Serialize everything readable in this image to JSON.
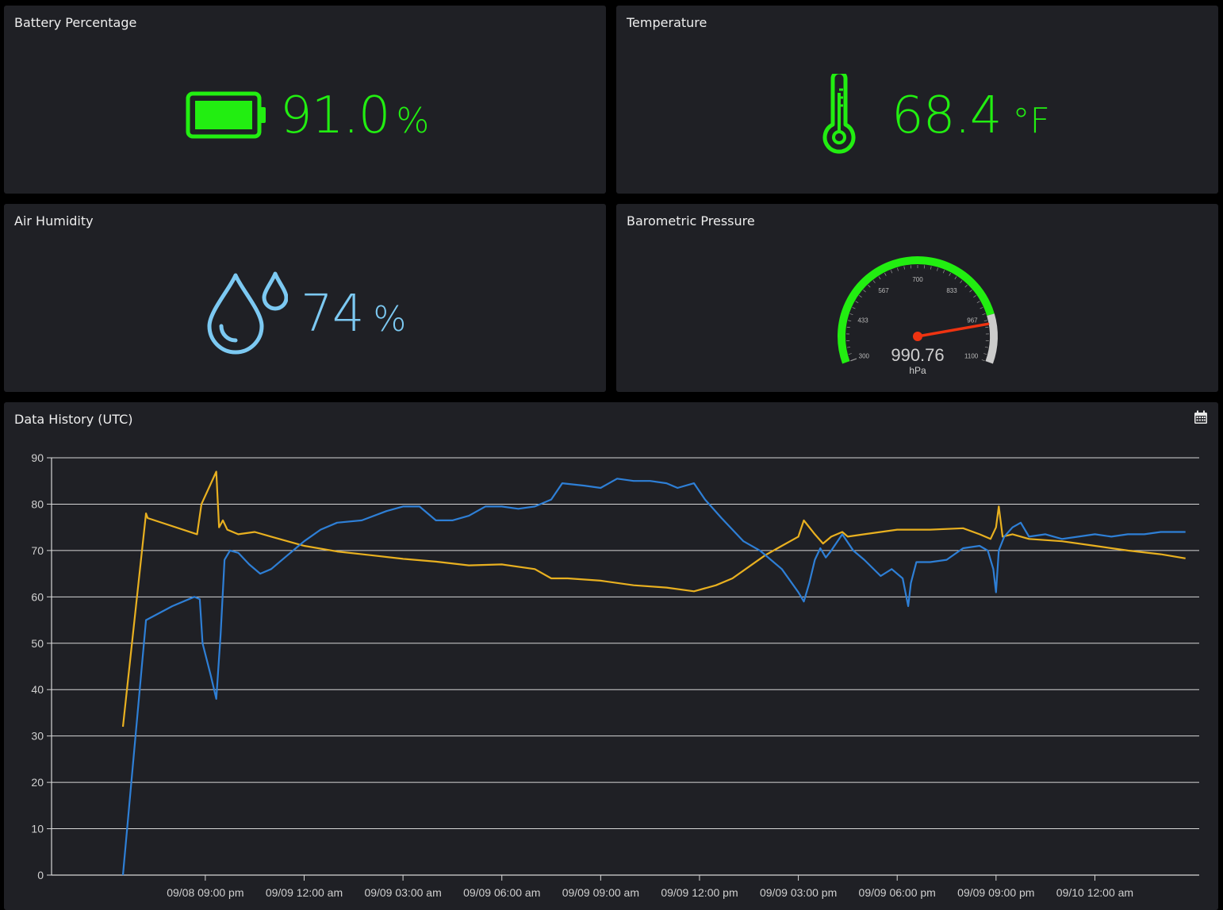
{
  "battery": {
    "title": "Battery Percentage",
    "value": "91.0",
    "unit": "%",
    "icon": "battery-full-icon",
    "color": "#22ee11"
  },
  "temperature": {
    "title": "Temperature",
    "value": "68.4",
    "unit": "°F",
    "icon": "thermometer-icon",
    "color": "#22ee11"
  },
  "humidity": {
    "title": "Air Humidity",
    "value": "74",
    "unit": "%",
    "icon": "water-drops-icon",
    "color": "#7cc9f2"
  },
  "pressure": {
    "title": "Barometric Pressure",
    "value": "990.76",
    "unit": "hPa",
    "min": 300,
    "max": 1100,
    "ticks": [
      "300",
      "433",
      "567",
      "700",
      "833",
      "967",
      "1100"
    ],
    "green_until": 967,
    "arc_color": "#22ee11",
    "rest_color": "#cccccc",
    "needle_color": "#ee3311"
  },
  "history": {
    "title": "Data History (UTC)",
    "calendar_icon": "calendar-icon"
  },
  "chart_data": {
    "type": "line",
    "title": "Data History (UTC)",
    "xlabel": "",
    "ylabel": "",
    "ylim": [
      0,
      90
    ],
    "yticks": [
      0,
      10,
      20,
      30,
      40,
      50,
      60,
      70,
      80,
      90
    ],
    "xlim": [
      "09/08 16:20",
      "09/10 03:10"
    ],
    "xticks": [
      {
        "label": "09/08 09:00 pm",
        "t": "09/08 21:00"
      },
      {
        "label": "09/09 12:00 am",
        "t": "09/09 00:00"
      },
      {
        "label": "09/09 03:00 am",
        "t": "09/09 03:00"
      },
      {
        "label": "09/09 06:00 am",
        "t": "09/09 06:00"
      },
      {
        "label": "09/09 09:00 am",
        "t": "09/09 09:00"
      },
      {
        "label": "09/09 12:00 pm",
        "t": "09/09 12:00"
      },
      {
        "label": "09/09 03:00 pm",
        "t": "09/09 15:00"
      },
      {
        "label": "09/09 06:00 pm",
        "t": "09/09 18:00"
      },
      {
        "label": "09/09 09:00 pm",
        "t": "09/09 21:00"
      },
      {
        "label": "09/10 12:00 am",
        "t": "09/10 00:00"
      }
    ],
    "grid": true,
    "series": [
      {
        "color": "#e8b020",
        "points": [
          [
            "09/08 18:30",
            32
          ],
          [
            "09/08 19:12",
            78
          ],
          [
            "09/08 19:15",
            77
          ],
          [
            "09/08 20:45",
            73.5
          ],
          [
            "09/08 20:53",
            80
          ],
          [
            "09/08 21:20",
            87
          ],
          [
            "09/08 21:25",
            75
          ],
          [
            "09/08 21:32",
            76.5
          ],
          [
            "09/08 21:40",
            74.5
          ],
          [
            "09/08 22:00",
            73.5
          ],
          [
            "09/08 22:30",
            74
          ],
          [
            "09/08 23:00",
            73
          ],
          [
            "09/09 00:00",
            71
          ],
          [
            "09/09 01:00",
            69.8
          ],
          [
            "09/09 02:00",
            69
          ],
          [
            "09/09 03:00",
            68.2
          ],
          [
            "09/09 04:00",
            67.6
          ],
          [
            "09/09 05:00",
            66.8
          ],
          [
            "09/09 06:00",
            67
          ],
          [
            "09/09 07:00",
            66
          ],
          [
            "09/09 07:30",
            64
          ],
          [
            "09/09 08:00",
            64
          ],
          [
            "09/09 09:00",
            63.5
          ],
          [
            "09/09 10:00",
            62.5
          ],
          [
            "09/09 11:00",
            62
          ],
          [
            "09/09 11:50",
            61.2
          ],
          [
            "09/09 12:30",
            62.5
          ],
          [
            "09/09 13:00",
            64
          ],
          [
            "09/09 13:30",
            66.5
          ],
          [
            "09/09 14:00",
            69
          ],
          [
            "09/09 14:30",
            71
          ],
          [
            "09/09 15:00",
            73
          ],
          [
            "09/09 15:10",
            76.5
          ],
          [
            "09/09 15:30",
            73.5
          ],
          [
            "09/09 15:45",
            71.5
          ],
          [
            "09/09 16:00",
            73
          ],
          [
            "09/09 16:20",
            74
          ],
          [
            "09/09 16:30",
            73
          ],
          [
            "09/09 17:00",
            73.5
          ],
          [
            "09/09 18:00",
            74.5
          ],
          [
            "09/09 19:00",
            74.5
          ],
          [
            "09/09 20:00",
            74.8
          ],
          [
            "09/09 20:30",
            73.5
          ],
          [
            "09/09 20:50",
            72.5
          ],
          [
            "09/09 21:00",
            75
          ],
          [
            "09/09 21:05",
            79.5
          ],
          [
            "09/09 21:12",
            73
          ],
          [
            "09/09 21:30",
            73.5
          ],
          [
            "09/09 22:00",
            72.5
          ],
          [
            "09/09 23:00",
            72
          ],
          [
            "09/10 00:00",
            71
          ],
          [
            "09/10 01:00",
            70
          ],
          [
            "09/10 02:00",
            69.2
          ],
          [
            "09/10 02:45",
            68.3
          ]
        ]
      },
      {
        "color": "#2e7fd6",
        "points": [
          [
            "09/08 18:30",
            0
          ],
          [
            "09/08 19:12",
            55
          ],
          [
            "09/08 20:00",
            58
          ],
          [
            "09/08 20:40",
            60
          ],
          [
            "09/08 20:50",
            59.5
          ],
          [
            "09/08 20:55",
            50
          ],
          [
            "09/08 21:10",
            43
          ],
          [
            "09/08 21:20",
            38
          ],
          [
            "09/08 21:28",
            52
          ],
          [
            "09/08 21:35",
            68
          ],
          [
            "09/08 21:45",
            70
          ],
          [
            "09/08 22:00",
            69.5
          ],
          [
            "09/08 22:20",
            67
          ],
          [
            "09/08 22:40",
            65
          ],
          [
            "09/08 23:00",
            66
          ],
          [
            "09/08 23:30",
            69
          ],
          [
            "09/09 00:00",
            72
          ],
          [
            "09/09 00:30",
            74.5
          ],
          [
            "09/09 01:00",
            76
          ],
          [
            "09/09 01:45",
            76.5
          ],
          [
            "09/09 02:30",
            78.5
          ],
          [
            "09/09 03:00",
            79.5
          ],
          [
            "09/09 03:30",
            79.5
          ],
          [
            "09/09 04:00",
            76.5
          ],
          [
            "09/09 04:30",
            76.5
          ],
          [
            "09/09 05:00",
            77.5
          ],
          [
            "09/09 05:30",
            79.5
          ],
          [
            "09/09 06:00",
            79.5
          ],
          [
            "09/09 06:30",
            79
          ],
          [
            "09/09 07:00",
            79.5
          ],
          [
            "09/09 07:30",
            81
          ],
          [
            "09/09 07:50",
            84.5
          ],
          [
            "09/09 08:30",
            84
          ],
          [
            "09/09 09:00",
            83.5
          ],
          [
            "09/09 09:30",
            85.5
          ],
          [
            "09/09 10:00",
            85
          ],
          [
            "09/09 10:30",
            85
          ],
          [
            "09/09 11:00",
            84.5
          ],
          [
            "09/09 11:20",
            83.5
          ],
          [
            "09/09 11:50",
            84.5
          ],
          [
            "09/09 12:10",
            81
          ],
          [
            "09/09 12:40",
            77
          ],
          [
            "09/09 13:20",
            72
          ],
          [
            "09/09 13:50",
            70
          ],
          [
            "09/09 14:30",
            66
          ],
          [
            "09/09 15:00",
            61
          ],
          [
            "09/09 15:10",
            59
          ],
          [
            "09/09 15:20",
            63
          ],
          [
            "09/09 15:30",
            68
          ],
          [
            "09/09 15:40",
            70.5
          ],
          [
            "09/09 15:50",
            68.5
          ],
          [
            "09/09 16:00",
            70
          ],
          [
            "09/09 16:20",
            73.5
          ],
          [
            "09/09 16:40",
            70
          ],
          [
            "09/09 17:00",
            68
          ],
          [
            "09/09 17:30",
            64.5
          ],
          [
            "09/09 17:50",
            66
          ],
          [
            "09/09 18:10",
            64
          ],
          [
            "09/09 18:20",
            58
          ],
          [
            "09/09 18:25",
            63
          ],
          [
            "09/09 18:35",
            67.5
          ],
          [
            "09/09 19:00",
            67.5
          ],
          [
            "09/09 19:30",
            68
          ],
          [
            "09/09 20:00",
            70.5
          ],
          [
            "09/09 20:30",
            71
          ],
          [
            "09/09 20:45",
            70
          ],
          [
            "09/09 20:55",
            66
          ],
          [
            "09/09 21:00",
            61
          ],
          [
            "09/09 21:05",
            70
          ],
          [
            "09/09 21:15",
            73
          ],
          [
            "09/09 21:30",
            75
          ],
          [
            "09/09 21:45",
            76
          ],
          [
            "09/09 22:00",
            73
          ],
          [
            "09/09 22:30",
            73.5
          ],
          [
            "09/09 23:00",
            72.5
          ],
          [
            "09/09 23:30",
            73
          ],
          [
            "09/10 00:00",
            73.5
          ],
          [
            "09/10 00:30",
            73
          ],
          [
            "09/10 01:00",
            73.5
          ],
          [
            "09/10 01:30",
            73.5
          ],
          [
            "09/10 02:00",
            74
          ],
          [
            "09/10 02:45",
            74
          ]
        ]
      }
    ]
  }
}
